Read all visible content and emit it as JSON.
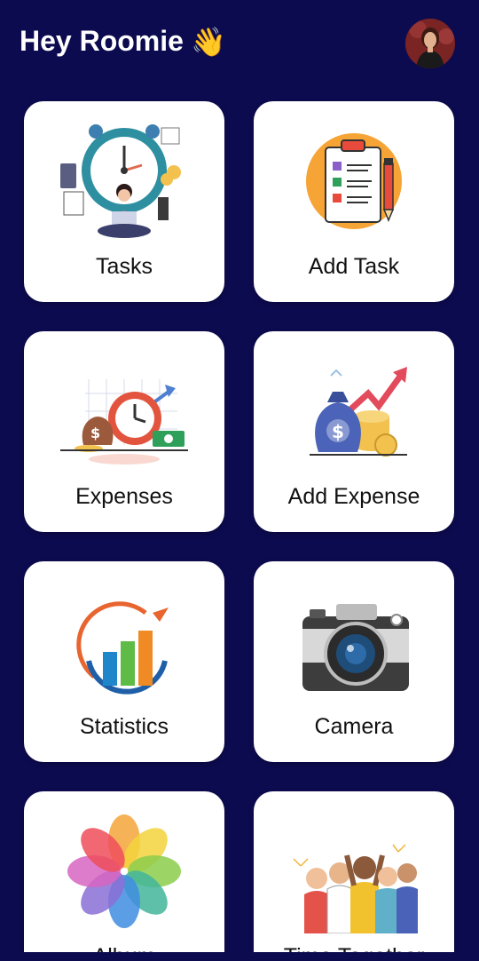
{
  "header": {
    "greeting": "Hey Roomie",
    "wave_emoji": "👋"
  },
  "tiles": [
    {
      "label": "Tasks",
      "icon": "task-clock-illustration-icon"
    },
    {
      "label": "Add Task",
      "icon": "clipboard-checklist-icon"
    },
    {
      "label": "Expenses",
      "icon": "money-clock-icon"
    },
    {
      "label": "Add Expense",
      "icon": "money-bag-growth-icon"
    },
    {
      "label": "Statistics",
      "icon": "bar-chart-growth-icon"
    },
    {
      "label": "Camera",
      "icon": "camera-icon"
    },
    {
      "label": "Album",
      "icon": "photos-flower-icon"
    },
    {
      "label": "Time Together",
      "icon": "friends-celebrating-icon"
    }
  ],
  "colors": {
    "background": "#0d0b4f",
    "card": "#ffffff",
    "text": "#111111"
  }
}
